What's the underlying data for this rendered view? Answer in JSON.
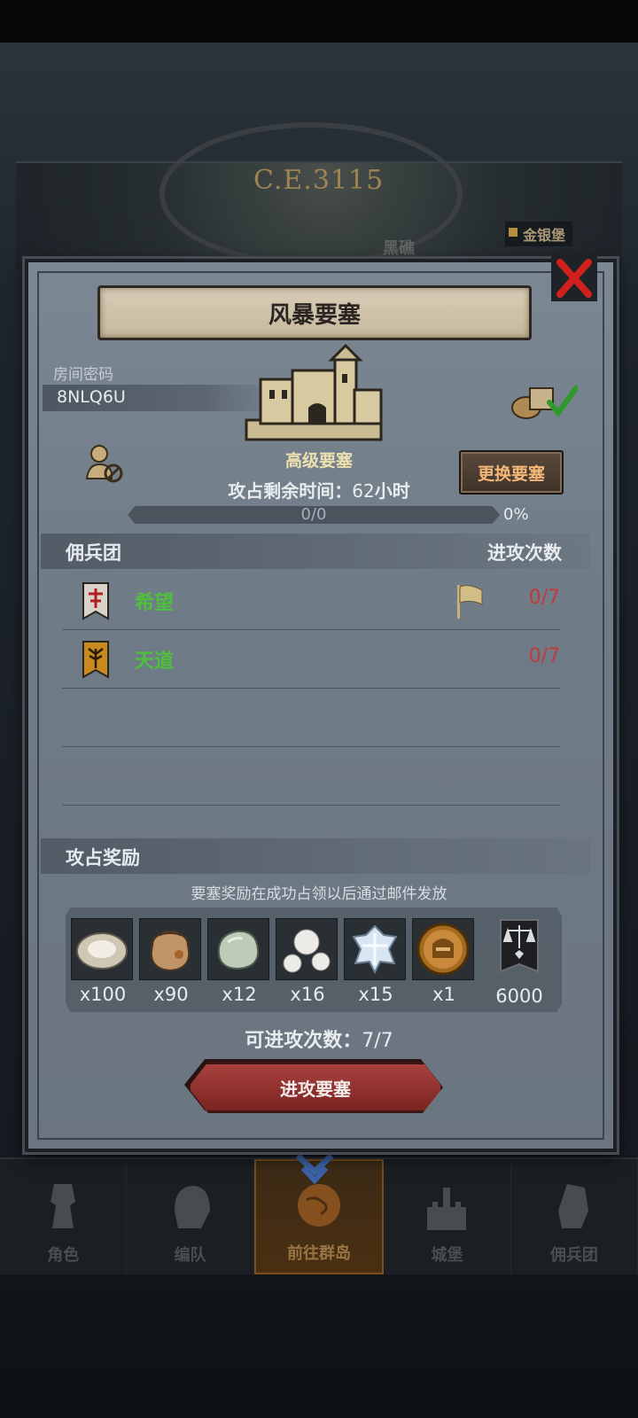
{
  "background": {
    "year_label": "C.E.3115",
    "fort_tag": "金银堡",
    "faint_label": "黑礁"
  },
  "dialog": {
    "title": "风暴要塞",
    "room": {
      "label": "房间密码",
      "code": "8NLQ6U"
    },
    "fort_level": "高级要塞",
    "time_left": {
      "label": "攻占剩余时间：",
      "value": "62",
      "unit": "小时"
    },
    "change_fort_label": "更换要塞",
    "progress": {
      "text": "0/0",
      "percent_label": "0%",
      "fraction": 0
    },
    "mercenary_section": {
      "left": "佣兵团",
      "right": "进攻次数"
    },
    "mercenaries": [
      {
        "name": "希望",
        "count": "0/7",
        "emblem": "red-banner-icon",
        "has_flag": true
      },
      {
        "name": "天道",
        "count": "0/7",
        "emblem": "gold-tree-banner-icon",
        "has_flag": false
      }
    ],
    "reward_section": {
      "title": "攻占奖励"
    },
    "reward_note": "要塞奖励在成功占领以后通过邮件发放",
    "rewards": [
      {
        "icon": "oyster-icon",
        "qty": "x100"
      },
      {
        "icon": "sack-icon",
        "qty": "x90"
      },
      {
        "icon": "jade-stone-icon",
        "qty": "x12"
      },
      {
        "icon": "pearls-icon",
        "qty": "x16"
      },
      {
        "icon": "crystal-icon",
        "qty": "x15"
      },
      {
        "icon": "helmet-medal-icon",
        "qty": "x1"
      },
      {
        "icon": "justice-banner-icon",
        "qty": "6000"
      }
    ],
    "attacks_left": {
      "label": "可进攻次数：",
      "value": "7/7"
    },
    "attack_button": "进攻要塞"
  },
  "nav": {
    "items": [
      {
        "label": "角色",
        "active": false
      },
      {
        "label": "编队",
        "active": false
      },
      {
        "label": "前往群岛",
        "active": true
      },
      {
        "label": "城堡",
        "active": false
      },
      {
        "label": "佣兵团",
        "active": false
      }
    ]
  },
  "colors": {
    "accent_gold": "#c89a45",
    "name_green": "#4fbf3e",
    "count_red": "#c03a3a",
    "button_red": "#a9413d"
  }
}
